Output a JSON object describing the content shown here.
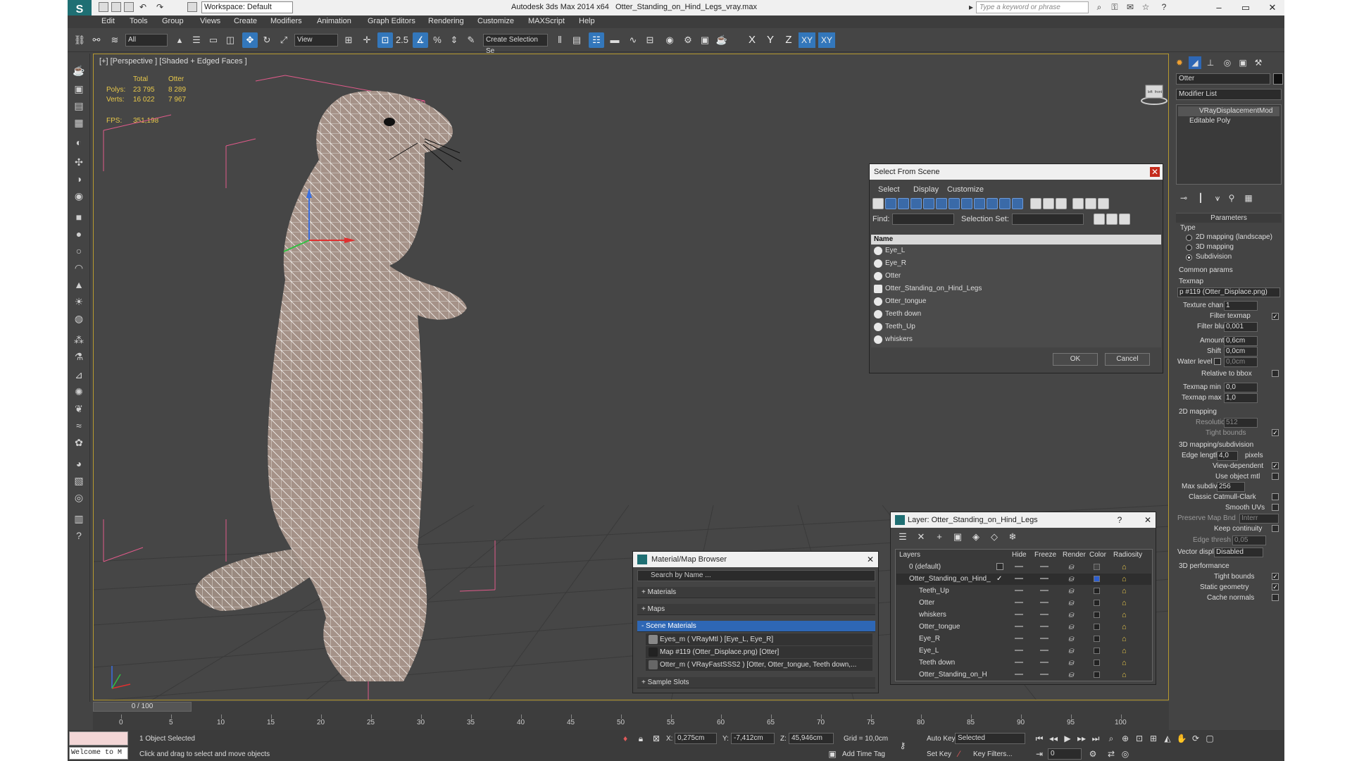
{
  "titlebar": {
    "app_title": "Autodesk 3ds Max  2014 x64",
    "file_name": "Otter_Standing_on_Hind_Legs_vray.max",
    "workspace": "Workspace: Default",
    "search_placeholder": "Type a keyword or phrase"
  },
  "menu": [
    "Edit",
    "Tools",
    "Group",
    "Views",
    "Create",
    "Modifiers",
    "Animation",
    "Graph Editors",
    "Rendering",
    "Customize",
    "MAXScript",
    "Help"
  ],
  "toolbar": {
    "filter_value": "All",
    "refcoord_value": "View",
    "selection_set_placeholder": "Create Selection Se",
    "axis_x": "X",
    "axis_y": "Y",
    "axis_z": "Z",
    "axis_xy": "XY",
    "axis_xy2": "XY"
  },
  "viewport": {
    "label": "[+] [Perspective ] [Shaded + Edged Faces ]",
    "stats": {
      "total_label": "Total",
      "obj_label": "Otter",
      "polys_label": "Polys:",
      "polys_total": "23 795",
      "polys_obj": "8 289",
      "verts_label": "Verts:",
      "verts_total": "16 022",
      "verts_obj": "7 967",
      "fps_label": "FPS:",
      "fps_value": "351,198"
    },
    "viewcube_left": "left",
    "viewcube_front": "front"
  },
  "select_from_scene": {
    "title": "Select From Scene",
    "menu": [
      "Select",
      "Display",
      "Customize"
    ],
    "find_label": "Find:",
    "selset_label": "Selection Set:",
    "column": "Name",
    "items": [
      "Eye_L",
      "Eye_R",
      "Otter",
      "Otter_Standing_on_Hind_Legs",
      "Otter_tongue",
      "Teeth down",
      "Teeth_Up",
      "whiskers"
    ],
    "ok": "OK",
    "cancel": "Cancel"
  },
  "material_browser": {
    "title": "Material/Map Browser",
    "search_placeholder": "Search by Name ...",
    "sections": [
      "+ Materials",
      "+ Maps",
      "- Scene Materials"
    ],
    "items": [
      "Eyes_m  ( VRayMtl ) [Eye_L, Eye_R]",
      "Map #119 (Otter_Displace.png) [Otter]",
      "Otter_m  ( VRayFastSSS2 ) [Otter, Otter_tongue, Teeth down,..."
    ],
    "sample_slots": "+ Sample Slots"
  },
  "layer_dialog": {
    "title": "Layer: Otter_Standing_on_Hind_Legs",
    "help": "?",
    "columns": [
      "Layers",
      "Hide",
      "Freeze",
      "Render",
      "Color",
      "Radiosity"
    ],
    "rows": [
      "0 (default)",
      "Otter_Standing_on_Hind_",
      "Teeth_Up",
      "Otter",
      "whiskers",
      "Otter_tongue",
      "Eye_R",
      "Eye_L",
      "Teeth down",
      "Otter_Standing_on_H"
    ]
  },
  "command_panel": {
    "object_name": "Otter",
    "modifier_list": "Modifier List",
    "stack": [
      "VRayDisplacementMod",
      "Editable Poly"
    ],
    "parameters": "Parameters",
    "type_label": "Type",
    "type_options": [
      "2D mapping (landscape)",
      "3D mapping",
      "Subdivision"
    ],
    "common_params": "Common params",
    "texmap_label": "Texmap",
    "texmap_value": "p #119 (Otter_Displace.png)",
    "texture_chan_label": "Texture chan",
    "texture_chan_value": "1",
    "filter_texmap_label": "Filter texmap",
    "filter_blur_label": "Filter blur",
    "filter_blur_value": "0,001",
    "amount_label": "Amount",
    "amount_value": "0,6cm",
    "shift_label": "Shift",
    "shift_value": "0,0cm",
    "water_label": "Water level",
    "water_value": "0,0cm",
    "relative_label": "Relative to bbox",
    "texmap_min_label": "Texmap min",
    "texmap_min_value": "0,0",
    "texmap_max_label": "Texmap max",
    "texmap_max_value": "1,0",
    "mapping2d_label": "2D mapping",
    "resolution_label": "Resolution",
    "resolution_value": "512",
    "tight_bounds_label": "Tight bounds",
    "mapping3d_label": "3D mapping/subdivision",
    "edge_length_label": "Edge length",
    "edge_length_value": "4,0",
    "pixels_label": "pixels",
    "view_dependent_label": "View-dependent",
    "use_object_mtl_label": "Use object mtl",
    "max_subdivs_label": "Max subdivs",
    "max_subdivs_value": "256",
    "catmull_label": "Classic Catmull-Clark",
    "smooth_uvs_label": "Smooth UVs",
    "preserve_label": "Preserve Map Bnd",
    "preserve_value": "Interr",
    "keep_continuity_label": "Keep continuity",
    "edge_thresh_label": "Edge thresh",
    "edge_thresh_value": "0,05",
    "vector_displ_label": "Vector displ",
    "vector_displ_value": "Disabled",
    "performance_label": "3D performance",
    "tight_bounds2_label": "Tight bounds",
    "static_geometry_label": "Static geometry",
    "cache_normals_label": "Cache normals"
  },
  "timeline": {
    "slider": "0 / 100",
    "ticks": [
      "0",
      "5",
      "10",
      "15",
      "20",
      "25",
      "30",
      "35",
      "40",
      "45",
      "50",
      "55",
      "60",
      "65",
      "70",
      "75",
      "80",
      "85",
      "90",
      "95",
      "100"
    ]
  },
  "status": {
    "welcome": "Welcome to M",
    "selected": "1 Object Selected",
    "prompt": "Click and drag to select and move objects",
    "x_label": "X:",
    "x_value": "0,275cm",
    "y_label": "Y:",
    "y_value": "-7,412cm",
    "z_label": "Z:",
    "z_value": "45,946cm",
    "grid": "Grid = 10,0cm",
    "add_time_tag": "Add Time Tag",
    "auto_key": "Auto Key",
    "selected_dropdown": "Selected",
    "set_key": "Set Key",
    "key_filters": "Key Filters...",
    "frame": "0"
  }
}
